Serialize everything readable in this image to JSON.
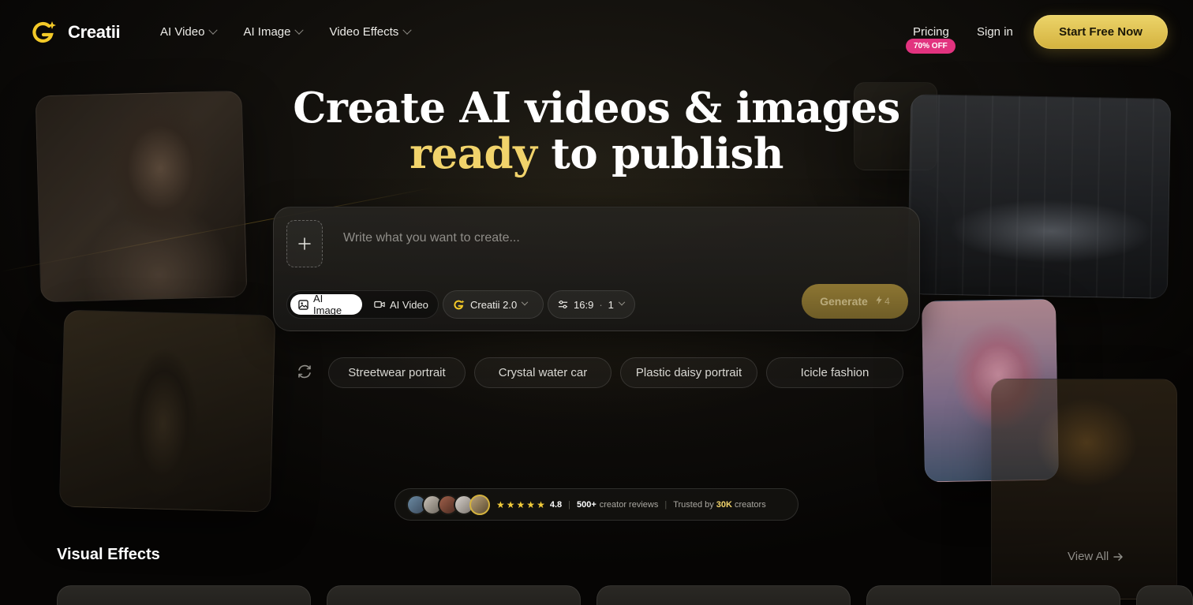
{
  "brand": {
    "name": "Creatii",
    "accent": "#f1d36b",
    "cta_color": "#e2c24f",
    "badge_color": "#e2337f"
  },
  "nav": {
    "menu": [
      {
        "label": "AI Video",
        "icon": "chevron-down-icon"
      },
      {
        "label": "AI Image",
        "icon": "chevron-down-icon"
      },
      {
        "label": "Video Effects",
        "icon": "chevron-down-icon"
      }
    ],
    "pricing": "Pricing",
    "pricing_badge": "70% OFF",
    "signin": "Sign in",
    "cta": "Start Free Now"
  },
  "hero": {
    "line1": "Create AI videos & images",
    "line2_accent": "ready",
    "line2_rest": " to publish"
  },
  "prompt": {
    "upload_icon": "plus-icon",
    "placeholder": "Write what you want to create...",
    "value": "",
    "modes": [
      {
        "label": "AI Image",
        "icon": "image-icon",
        "active": true
      },
      {
        "label": "AI Video",
        "icon": "video-camera-icon",
        "active": false
      }
    ],
    "model": {
      "label": "Creatii 2.0",
      "icon": "creatii-logo-icon"
    },
    "settings": {
      "icon": "sliders-icon",
      "ratio": "16:9",
      "dot": "·",
      "count": "1"
    },
    "generate": {
      "label": "Generate",
      "icon": "lightning-icon",
      "cost": "4"
    }
  },
  "suggestions": {
    "refresh_icon": "refresh-icon",
    "items": [
      "Streetwear portrait",
      "Crystal water car",
      "Plastic daisy portrait",
      "Icicle fashion"
    ]
  },
  "reviews": {
    "rating": "4.8",
    "count": "500+",
    "count_label": "creator reviews",
    "trusted_prefix": "Trusted by",
    "trusted_number": "30K",
    "trusted_suffix": "creators",
    "star_count": 5
  },
  "section": {
    "title": "Visual Effects",
    "view_all": "View All",
    "view_all_icon": "arrow-right-icon"
  }
}
